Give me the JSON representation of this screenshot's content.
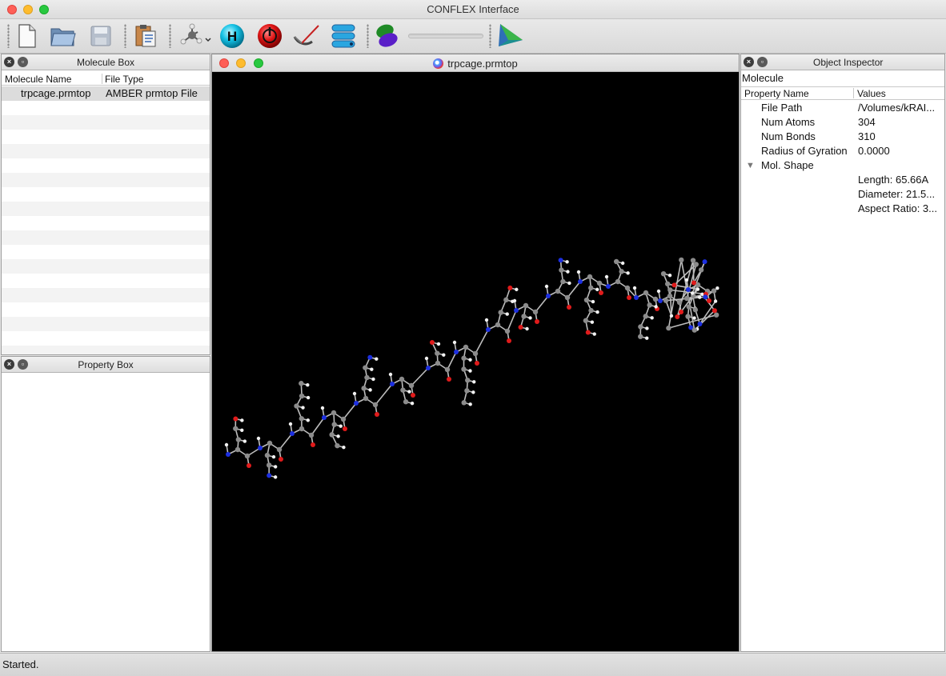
{
  "window": {
    "title": "CONFLEX Interface"
  },
  "toolbar": {
    "icons": [
      "new-file-icon",
      "open-folder-icon",
      "save-disk-icon",
      "import-clipboard-icon",
      "molecule-builder-icon",
      "hydrogen-icon",
      "stop-icon",
      "measure-icon",
      "database-stack-icon",
      "orbital-icon",
      "triangle-view-icon"
    ],
    "hydrogen_label": "H"
  },
  "molecule_box": {
    "title": "Molecule Box",
    "columns": [
      "Molecule Name",
      "File Type"
    ],
    "rows": [
      {
        "name": "trpcage.prmtop",
        "type": "AMBER prmtop File"
      }
    ]
  },
  "property_box": {
    "title": "Property Box"
  },
  "viewer": {
    "title": "trpcage.prmtop"
  },
  "inspector": {
    "title": "Object Inspector",
    "object_class": "Molecule",
    "columns": [
      "Property Name",
      "Values"
    ],
    "properties": [
      {
        "name": "File Path",
        "value": "/Volumes/kRAI..."
      },
      {
        "name": "Num Atoms",
        "value": "304"
      },
      {
        "name": "Num Bonds",
        "value": "310"
      },
      {
        "name": "Radius of Gyration",
        "value": "0.0000"
      },
      {
        "name": "Mol. Shape",
        "value": ""
      },
      {
        "name": "",
        "value": "Length: 65.66A"
      },
      {
        "name": "",
        "value": "Diameter: 21.5..."
      },
      {
        "name": "",
        "value": "Aspect Ratio: 3..."
      }
    ]
  },
  "status": {
    "text": "Started."
  },
  "colors": {
    "carbon": "#8c8c8c",
    "hydrogen": "#f2f2f2",
    "oxygen": "#e01b1b",
    "nitrogen": "#1c2fe0",
    "background": "#000000"
  }
}
